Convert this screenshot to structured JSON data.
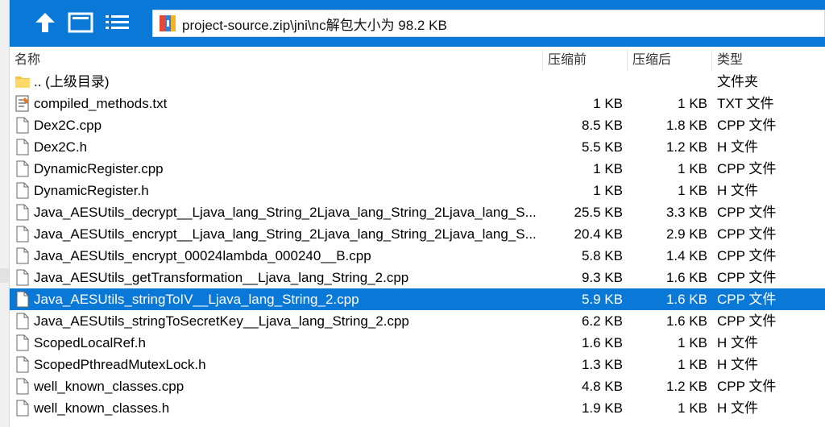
{
  "toolbar": {
    "up_icon": "arrow-up-icon",
    "view_icon": "details-view-icon",
    "list_icon": "list-view-icon",
    "zip_icon": "zip-archive-icon",
    "address_path": "project-source.zip\\jni\\nc解包大小为 98.2 KB",
    "bar_color": "#0a78d7"
  },
  "columns": {
    "name": "名称",
    "compressed": "压缩前",
    "size": "压缩后",
    "type": "类型"
  },
  "rows": [
    {
      "name": ".. (上级目录)",
      "compressed": "",
      "size": "",
      "type": "文件夹",
      "icon": "folder-icon"
    },
    {
      "name": "compiled_methods.txt",
      "compressed": "1 KB",
      "size": "1 KB",
      "type": "TXT 文件",
      "icon": "text-file-icon"
    },
    {
      "name": "Dex2C.cpp",
      "compressed": "8.5 KB",
      "size": "1.8 KB",
      "type": "CPP 文件",
      "icon": "file-icon"
    },
    {
      "name": "Dex2C.h",
      "compressed": "5.5 KB",
      "size": "1.2 KB",
      "type": "H 文件",
      "icon": "file-icon"
    },
    {
      "name": "DynamicRegister.cpp",
      "compressed": "1 KB",
      "size": "1 KB",
      "type": "CPP 文件",
      "icon": "file-icon"
    },
    {
      "name": "DynamicRegister.h",
      "compressed": "1 KB",
      "size": "1 KB",
      "type": "H 文件",
      "icon": "file-icon"
    },
    {
      "name": "Java_AESUtils_decrypt__Ljava_lang_String_2Ljava_lang_String_2Ljava_lang_S...",
      "compressed": "25.5 KB",
      "size": "3.3 KB",
      "type": "CPP 文件",
      "icon": "file-icon"
    },
    {
      "name": "Java_AESUtils_encrypt__Ljava_lang_String_2Ljava_lang_String_2Ljava_lang_S...",
      "compressed": "20.4 KB",
      "size": "2.9 KB",
      "type": "CPP 文件",
      "icon": "file-icon"
    },
    {
      "name": "Java_AESUtils_encrypt_00024lambda_000240__B.cpp",
      "compressed": "5.8 KB",
      "size": "1.4 KB",
      "type": "CPP 文件",
      "icon": "file-icon"
    },
    {
      "name": "Java_AESUtils_getTransformation__Ljava_lang_String_2.cpp",
      "compressed": "9.3 KB",
      "size": "1.6 KB",
      "type": "CPP 文件",
      "icon": "file-icon"
    },
    {
      "name": "Java_AESUtils_stringToIV__Ljava_lang_String_2.cpp",
      "compressed": "5.9 KB",
      "size": "1.6 KB",
      "type": "CPP 文件",
      "icon": "file-icon",
      "selected": true
    },
    {
      "name": "Java_AESUtils_stringToSecretKey__Ljava_lang_String_2.cpp",
      "compressed": "6.2 KB",
      "size": "1.6 KB",
      "type": "CPP 文件",
      "icon": "file-icon"
    },
    {
      "name": "ScopedLocalRef.h",
      "compressed": "1.6 KB",
      "size": "1 KB",
      "type": "H 文件",
      "icon": "file-icon"
    },
    {
      "name": "ScopedPthreadMutexLock.h",
      "compressed": "1.3 KB",
      "size": "1 KB",
      "type": "H 文件",
      "icon": "file-icon"
    },
    {
      "name": "well_known_classes.cpp",
      "compressed": "4.8 KB",
      "size": "1.2 KB",
      "type": "CPP 文件",
      "icon": "file-icon"
    },
    {
      "name": "well_known_classes.h",
      "compressed": "1.9 KB",
      "size": "1 KB",
      "type": "H 文件",
      "icon": "file-icon"
    }
  ]
}
